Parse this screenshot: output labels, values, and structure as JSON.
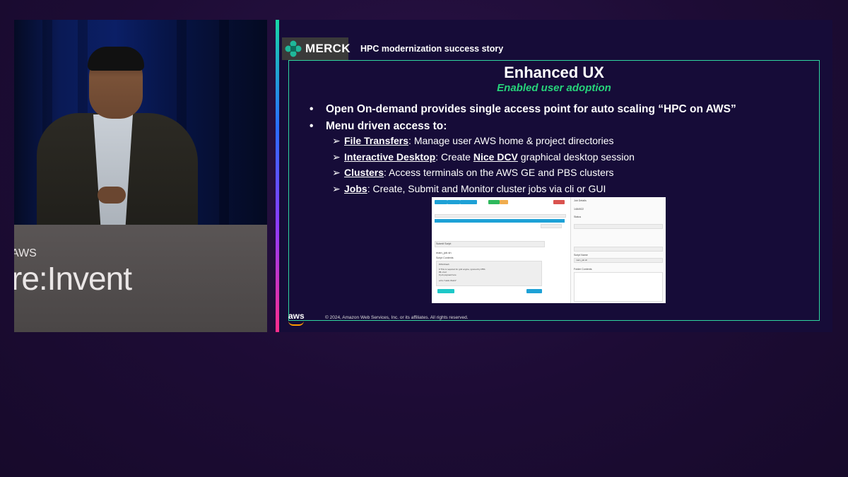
{
  "video": {
    "podium_logo_prefix": "AWS",
    "podium_logo_main": "re:Invent"
  },
  "slide": {
    "brand": "MERCK",
    "header": "HPC modernization success story",
    "title": "Enhanced UX",
    "subtitle": "Enabled user adoption",
    "bullets": [
      "Open On-demand provides single access point for auto scaling “HPC on AWS”",
      "Menu driven access to:"
    ],
    "sub_items": [
      {
        "label": "File Transfers",
        "rest": ": Manage user AWS home & project directories"
      },
      {
        "label": "Interactive Desktop",
        "rest_a": ": Create ",
        "label2": "Nice DCV",
        "rest_b": " graphical desktop session"
      },
      {
        "label": "Clusters",
        "rest": ": Access terminals on the AWS GE and PBS clusters"
      },
      {
        "label": "Jobs",
        "rest": ": Create, Submit and Monitor cluster jobs via cli or GUI"
      }
    ],
    "footer_logo": "aws",
    "copyright": "© 2024, Amazon Web Services, Inc. or its affiliates. All rights reserved."
  },
  "screenshot": {
    "submit_script_label": "Submit Script",
    "script_file": "main_job.sh",
    "script_contents_label": "Script Contents",
    "script_lines": [
      "#!/bin/bash",
      "# This is required for grid engine, ignored by PBS",
      "#$ -cwd",
      "# job payload here",
      "echo \"Hello World\""
    ],
    "job_details_label": "Job Details",
    "job_id": "1484922",
    "status_label": "Status",
    "folder_contents_label": "Folder Contents",
    "script_name_label": "Script Name",
    "script_name_value": "main_job.sh"
  },
  "colors": {
    "accent_green": "#26d37a",
    "frame_green": "#2fd6a0",
    "slide_bg": "#160c38",
    "page_bg": "#1d0c35"
  }
}
